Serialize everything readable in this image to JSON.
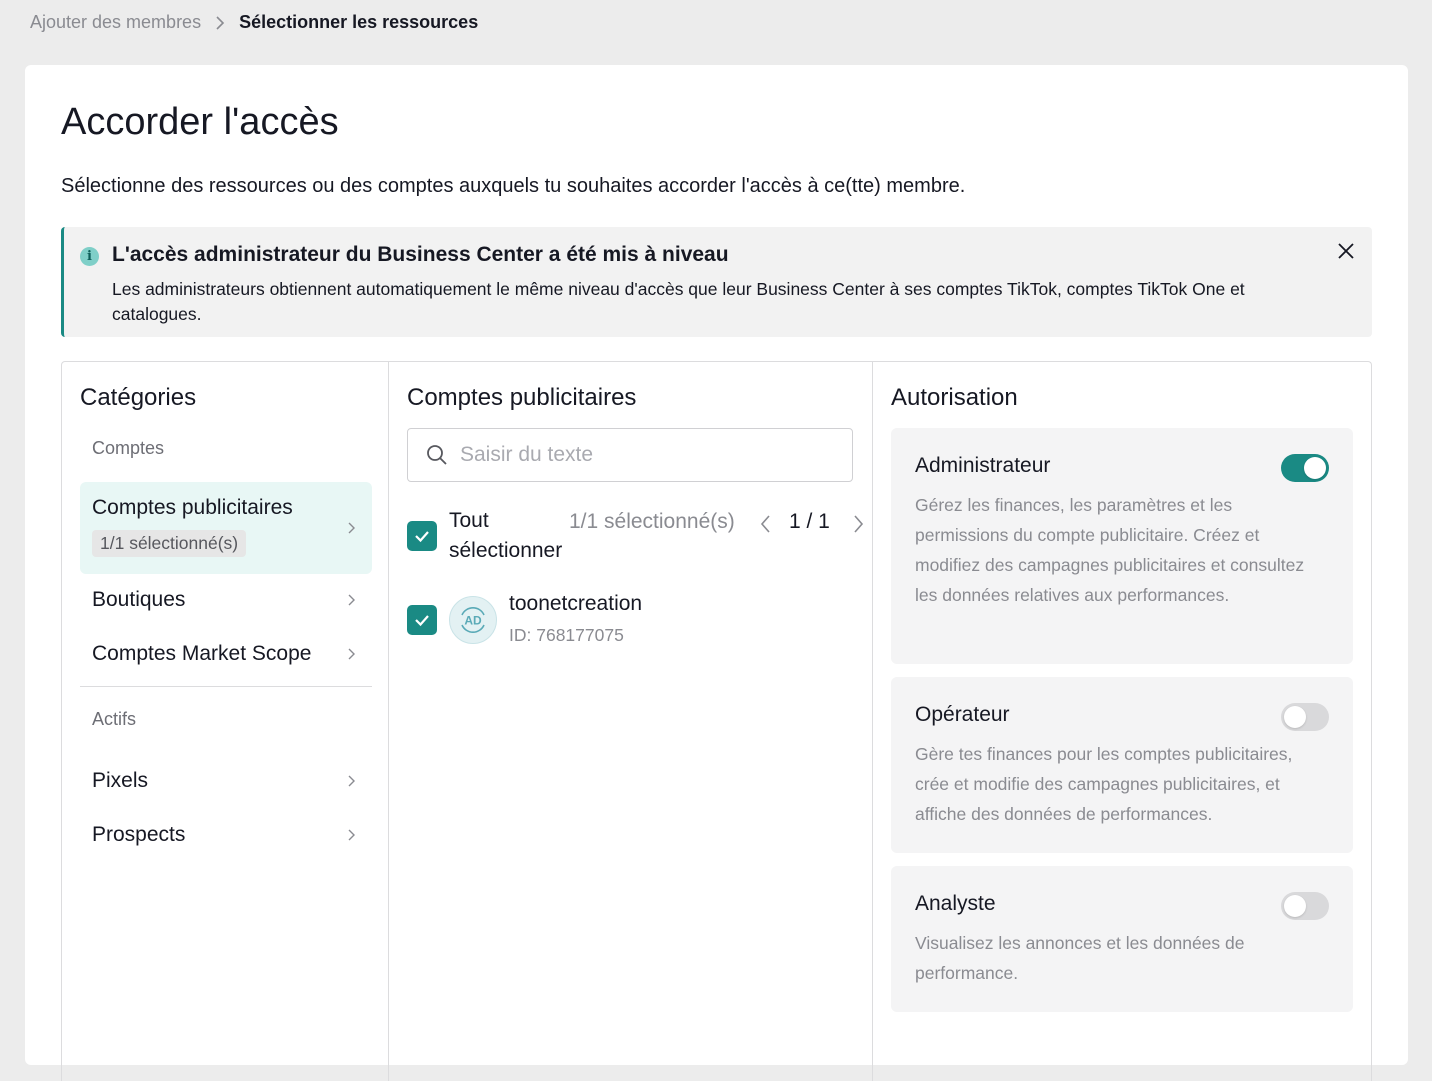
{
  "breadcrumb": {
    "previous": "Ajouter des membres",
    "current": "Sélectionner les ressources"
  },
  "page": {
    "title": "Accorder l'accès",
    "subtitle": "Sélectionne des ressources ou des comptes auxquels tu souhaites accorder l'accès à ce(tte) membre."
  },
  "banner": {
    "title": "L'accès administrateur du Business Center a été mis à niveau",
    "text": "Les administrateurs obtiennent automatiquement le même niveau d'accès que leur Business Center à ses comptes TikTok, comptes TikTok One et catalogues."
  },
  "categories": {
    "title": "Catégories",
    "section_accounts": "Comptes",
    "section_assets": "Actifs",
    "items": [
      {
        "label": "Comptes publicitaires",
        "badge": "1/1 sélectionné(s)"
      },
      {
        "label": "Boutiques"
      },
      {
        "label": "Comptes Market Scope"
      },
      {
        "label": "Pixels"
      },
      {
        "label": "Prospects"
      }
    ]
  },
  "accounts": {
    "title": "Comptes publicitaires",
    "search_placeholder": "Saisir du texte",
    "select_all": "Tout sélectionner",
    "selected_count": "1/1 sélectionné(s)",
    "pager": "1 / 1",
    "list": [
      {
        "avatar": "AD",
        "name": "toonetcreation",
        "id": "ID: 768177075"
      }
    ]
  },
  "authorization": {
    "title": "Autorisation",
    "roles": [
      {
        "name": "Administrateur",
        "enabled": true,
        "description": "Gérez les finances, les paramètres et les permissions du compte publicitaire. Créez et modifiez des campagnes publicitaires et consultez les données relatives aux performances."
      },
      {
        "name": "Opérateur",
        "enabled": false,
        "description": "Gère tes finances pour les comptes publicitaires, crée et modifie des campagnes publicitaires, et affiche des données de performances."
      },
      {
        "name": "Analyste",
        "enabled": false,
        "description": "Visualisez les annonces et les données de performance."
      }
    ]
  },
  "colors": {
    "accent": "#1a8a84",
    "active_bg": "#e8f7f5",
    "muted_text": "#8a8b91"
  }
}
